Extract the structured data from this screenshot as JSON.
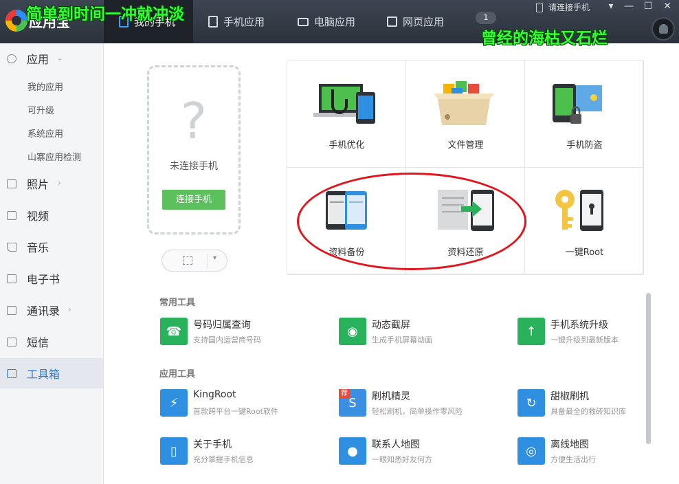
{
  "header": {
    "app_name": "应用宝",
    "overlay_left": "简单到时间一冲就冲淡",
    "overlay_right": "曾经的海枯又石烂",
    "tabs": [
      {
        "label": "我的手机"
      },
      {
        "label": "手机应用"
      },
      {
        "label": "电脑应用"
      },
      {
        "label": "网页应用"
      }
    ],
    "badge": "1",
    "connect_hint": "请连接手机",
    "menu_glyph": "▾",
    "minimize_glyph": "—",
    "maximize_glyph": "☐",
    "close_glyph": "✕"
  },
  "sidebar": {
    "apps": "应用",
    "app_subitems": [
      "我的应用",
      "可升级",
      "系统应用",
      "山寨应用检测"
    ],
    "photos": "照片",
    "video": "视频",
    "music": "音乐",
    "ebook": "电子书",
    "contacts": "通讯录",
    "sms": "短信",
    "toolbox": "工具箱",
    "arrow_down": "⌄",
    "arrow_right": "›"
  },
  "phone_card": {
    "question": "?",
    "status": "未连接手机",
    "connect_button": "连接手机",
    "dropdown_glyph": "▾"
  },
  "grid": {
    "items": [
      {
        "label": "手机优化"
      },
      {
        "label": "文件管理"
      },
      {
        "label": "手机防盗"
      },
      {
        "label": "资料备份"
      },
      {
        "label": "资料还原"
      },
      {
        "label": "一键Root"
      }
    ]
  },
  "common_tools": {
    "title": "常用工具",
    "items": [
      {
        "name": "号码归属查询",
        "desc": "支持国内运营商号码"
      },
      {
        "name": "动态截屏",
        "desc": "生成手机屏幕动画"
      },
      {
        "name": "手机系统升级",
        "desc": "一键升级到最新版本"
      }
    ]
  },
  "app_tools": {
    "title": "应用工具",
    "items": [
      {
        "name": "KingRoot",
        "desc": "首款跨平台一键Root软件"
      },
      {
        "name": "刷机精灵",
        "desc": "轻松刷机，简单操作零风险",
        "tag": "荐"
      },
      {
        "name": "甜椒刷机",
        "desc": "具备最全的救砖知识库"
      },
      {
        "name": "关于手机",
        "desc": "充分掌握手机信息"
      },
      {
        "name": "联系人地图",
        "desc": "一眼知悉好友何方"
      },
      {
        "name": "离线地图",
        "desc": "方便生活出行"
      }
    ]
  }
}
